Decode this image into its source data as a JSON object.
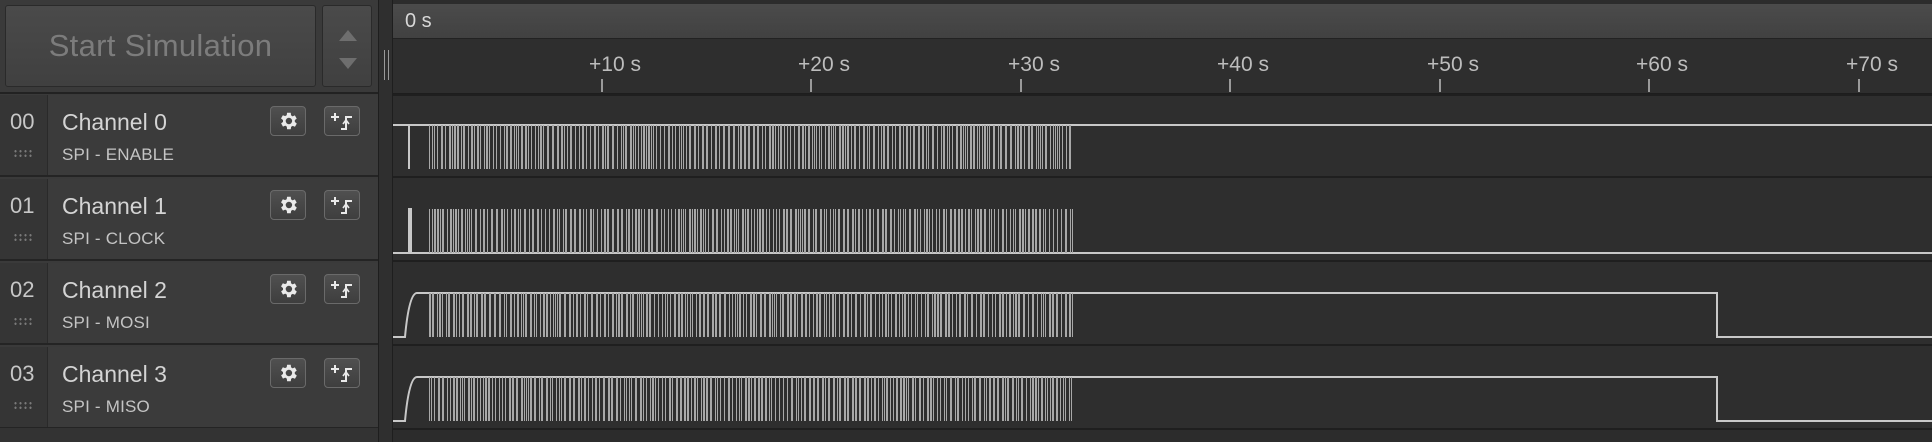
{
  "toolbar": {
    "start_simulation_label": "Start Simulation",
    "scroll_up_icon": "triangle-up-icon",
    "scroll_down_icon": "triangle-down-icon"
  },
  "timeline": {
    "origin_label": "0 s",
    "ticks": [
      "+10 s",
      "+20 s",
      "+30 s",
      "+40 s",
      "+50 s",
      "+60 s",
      "+70 s"
    ]
  },
  "channels": [
    {
      "number": "00",
      "name": "Channel 0",
      "description": "SPI - ENABLE",
      "color": "#2a2a2a",
      "settings_icon": "gear-icon",
      "trigger_icon": "rising-edge-trigger-icon"
    },
    {
      "number": "01",
      "name": "Channel 1",
      "description": "SPI - CLOCK",
      "color": "#8a5a2b",
      "settings_icon": "gear-icon",
      "trigger_icon": "rising-edge-trigger-icon"
    },
    {
      "number": "02",
      "name": "Channel 2",
      "description": "SPI - MOSI",
      "color": "#d42f2f",
      "settings_icon": "gear-icon",
      "trigger_icon": "rising-edge-trigger-icon"
    },
    {
      "number": "03",
      "name": "Channel 3",
      "description": "SPI - MISO",
      "color": "#e5901b",
      "settings_icon": "gear-icon",
      "trigger_icon": "rising-edge-trigger-icon"
    }
  ]
}
